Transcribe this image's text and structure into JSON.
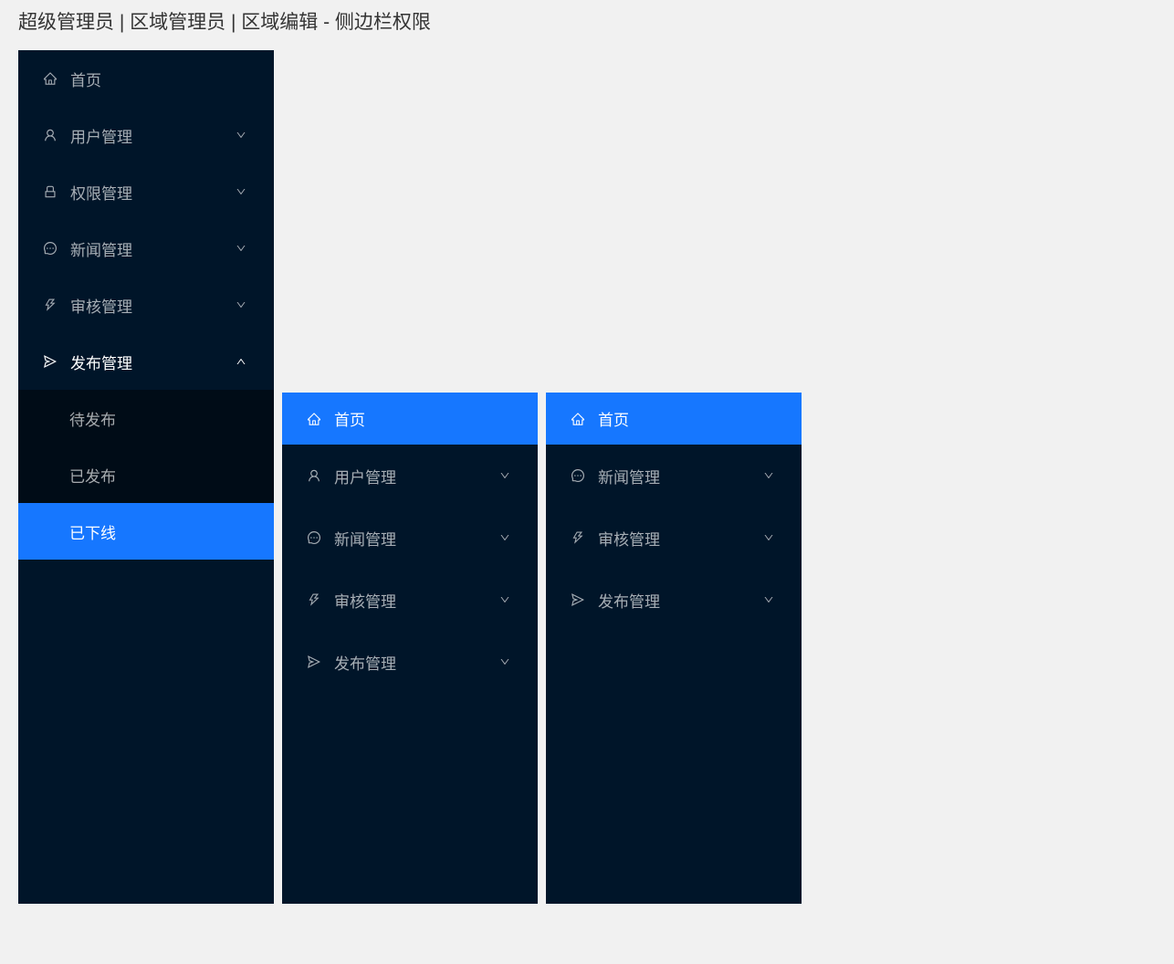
{
  "page": {
    "title": "超级管理员 | 区域管理员 | 区域编辑 - 侧边栏权限"
  },
  "colors": {
    "sidebar_bg": "#001529",
    "sidebar_sub_bg": "#000c17",
    "accent": "#1677ff",
    "text_muted": "rgba(255,255,255,0.65)",
    "text_active": "#ffffff"
  },
  "sidebars": {
    "main": {
      "items": [
        {
          "icon": "home-icon",
          "label": "首页",
          "expandable": false
        },
        {
          "icon": "user-icon",
          "label": "用户管理",
          "expandable": true
        },
        {
          "icon": "lock-icon",
          "label": "权限管理",
          "expandable": true
        },
        {
          "icon": "message-icon",
          "label": "新闻管理",
          "expandable": true
        },
        {
          "icon": "thunderbolt-icon",
          "label": "审核管理",
          "expandable": true
        },
        {
          "icon": "send-icon",
          "label": "发布管理",
          "expandable": true,
          "open": true,
          "children": [
            {
              "label": "待发布"
            },
            {
              "label": "已发布"
            },
            {
              "label": "已下线",
              "selected": true
            }
          ]
        }
      ]
    },
    "mid": {
      "items": [
        {
          "icon": "home-icon",
          "label": "首页",
          "selected": true
        },
        {
          "icon": "user-icon",
          "label": "用户管理",
          "expandable": true
        },
        {
          "icon": "message-icon",
          "label": "新闻管理",
          "expandable": true
        },
        {
          "icon": "thunderbolt-icon",
          "label": "审核管理",
          "expandable": true
        },
        {
          "icon": "send-icon",
          "label": "发布管理",
          "expandable": true
        }
      ]
    },
    "right": {
      "items": [
        {
          "icon": "home-icon",
          "label": "首页",
          "selected": true
        },
        {
          "icon": "message-icon",
          "label": "新闻管理",
          "expandable": true
        },
        {
          "icon": "thunderbolt-icon",
          "label": "审核管理",
          "expandable": true
        },
        {
          "icon": "send-icon",
          "label": "发布管理",
          "expandable": true
        }
      ]
    }
  }
}
